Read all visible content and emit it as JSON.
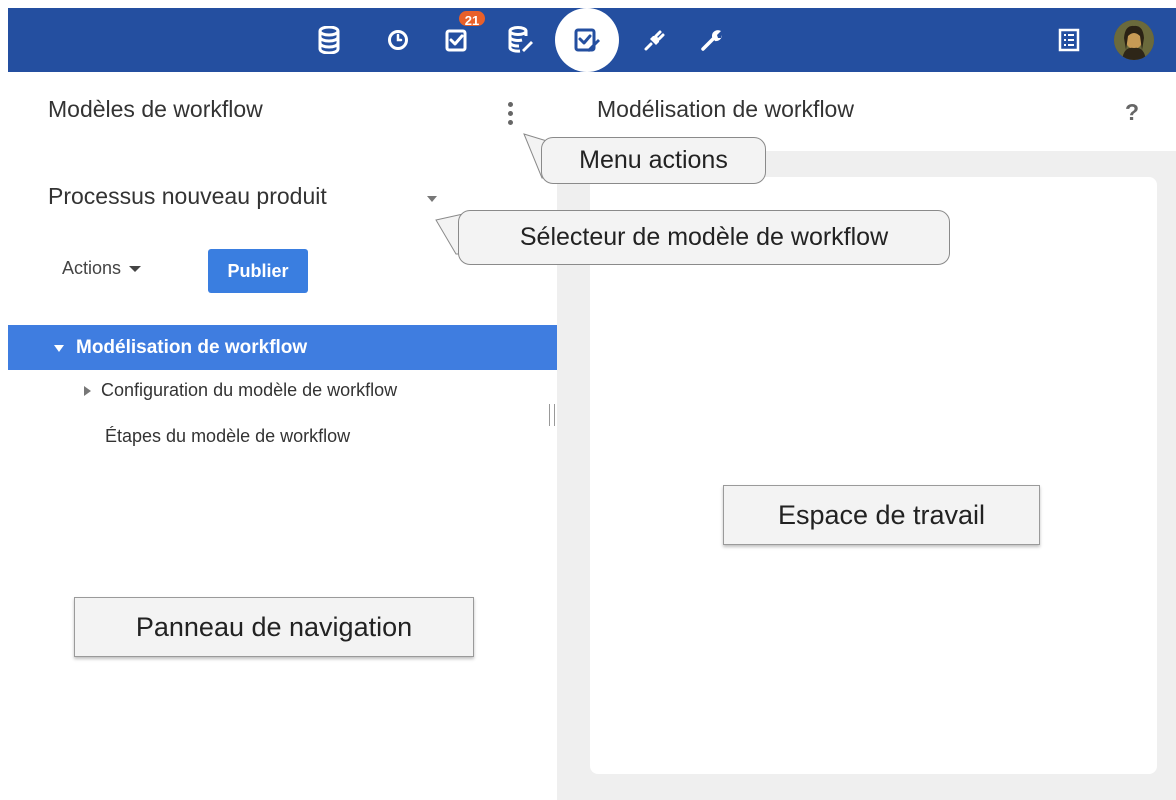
{
  "topbar": {
    "icons": [
      "database-icon",
      "clock-icon",
      "tasks-icon",
      "data-edit-icon",
      "workflow-icon",
      "plug-icon",
      "wrench-icon",
      "list-icon"
    ],
    "badge": "21",
    "active_icon": "workflow-icon",
    "color": "#244fa0"
  },
  "left": {
    "title": "Modèles de workflow",
    "selected_model": "Processus nouveau produit",
    "actions_label": "Actions",
    "publish_label": "Publier",
    "tree": {
      "root": "Modélisation de workflow",
      "children": [
        "Configuration du modèle de workflow",
        "Étapes du modèle de workflow"
      ]
    }
  },
  "right": {
    "title": "Modélisation de workflow",
    "help": "?"
  },
  "annotations": {
    "menu_actions": "Menu actions",
    "model_selector": "Sélecteur de modèle de workflow",
    "workspace": "Espace de travail",
    "navigation_panel": "Panneau de navigation"
  },
  "colors": {
    "accent": "#3f7de0",
    "publish": "#3a7ee0",
    "badge": "#e8602a"
  }
}
